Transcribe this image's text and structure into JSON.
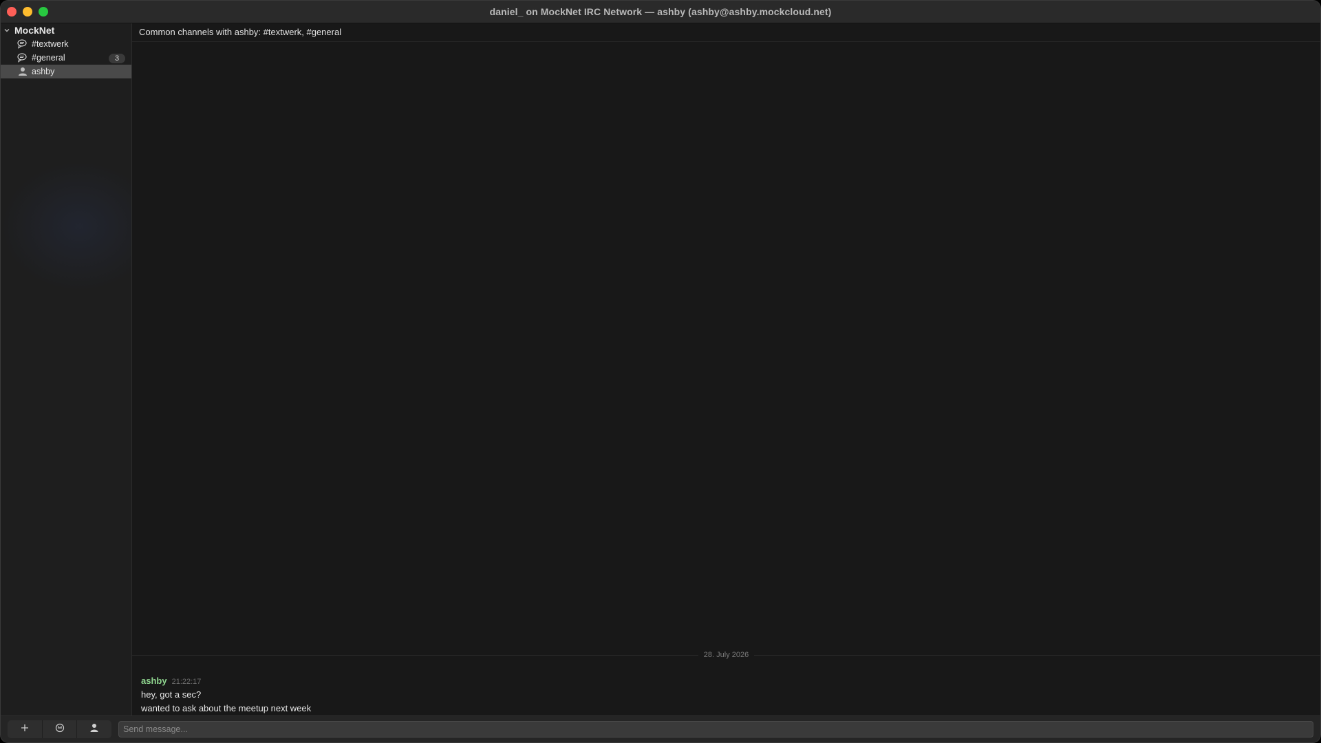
{
  "window": {
    "title": "daniel_ on MockNet IRC Network — ashby (ashby@ashby.mockcloud.net)"
  },
  "sidebar": {
    "network": "MockNet",
    "items": [
      {
        "label": "#textwerk",
        "icon": "chat-bubbles-icon",
        "badge": ""
      },
      {
        "label": "#general",
        "icon": "chat-bubbles-icon",
        "badge": "3"
      },
      {
        "label": "ashby",
        "icon": "person-icon",
        "badge": "",
        "selected": true
      }
    ]
  },
  "main": {
    "topic": "Common channels with ashby: #textwerk, #general",
    "date_separator": "28. July 2026",
    "message": {
      "nick": "ashby",
      "time": "21:22:17",
      "lines": [
        "hey, got a sec?",
        "wanted to ask about the meetup next week"
      ]
    }
  },
  "bottombar": {
    "buttons": [
      "plus-icon",
      "emoji-icon",
      "person-icon"
    ],
    "input_placeholder": "Send message...",
    "input_value": ""
  },
  "colors": {
    "nick": "#8fd58f",
    "close": "#fe5f57",
    "minimize": "#febc2e",
    "maximize": "#28c840"
  }
}
